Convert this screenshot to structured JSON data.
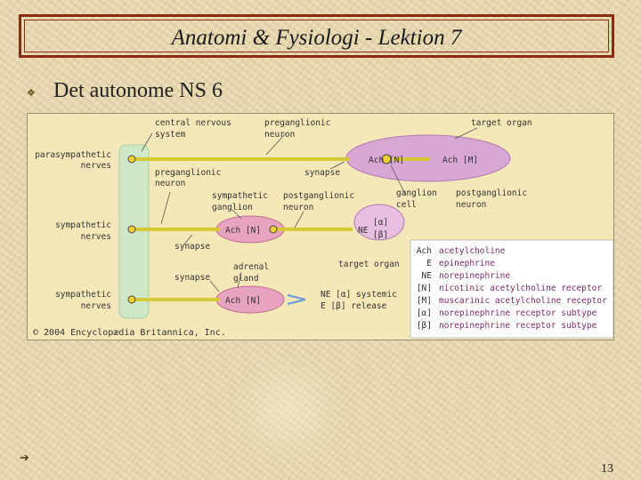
{
  "slide": {
    "title": "Anatomi & Fysiologi - Lektion 7",
    "bullet_text": "Det autonome NS 6",
    "page_number": "13"
  },
  "figure": {
    "labels": {
      "cns": [
        "central nervous",
        "system"
      ],
      "pre_neuron": [
        "preganglionic",
        "neuron"
      ],
      "target_organ_top": "target organ",
      "parasym": [
        "parasympathetic",
        "nerves"
      ],
      "pre_neuron_2": [
        "preganglionic",
        "neuron"
      ],
      "synapse_1": "synapse",
      "ach_n_1": "Ach [N]",
      "ach_m": "Ach [M]",
      "symp_ganglion": [
        "sympathetic",
        "ganglion"
      ],
      "post_neuron_1": [
        "postganglionic",
        "neuron"
      ],
      "ganglion_cell": [
        "ganglion",
        "cell"
      ],
      "post_neuron_2": [
        "postganglionic",
        "neuron"
      ],
      "sym_nerves_1": [
        "sympathetic",
        "nerves"
      ],
      "ach_n_2": "Ach [N]",
      "ne_1": "NE",
      "alpha_1": "[α]",
      "beta_1": "[β]",
      "synapse_2": "synapse",
      "target_organ_mid": "target organ",
      "adrenal": [
        "adrenal",
        "gland"
      ],
      "synapse_3": "synapse",
      "sym_nerves_2": [
        "sympathetic",
        "nerves"
      ],
      "ach_n_3": "Ach [N]",
      "release_1": "NE [α] systemic",
      "release_2": "E  [β] release",
      "copyright": "© 2004 Encyclopædia Britannica, Inc."
    },
    "legend": [
      {
        "abbr": "Ach",
        "desc": "acetylcholine"
      },
      {
        "abbr": "E",
        "desc": "epinephrine"
      },
      {
        "abbr": "NE",
        "desc": "norepinephrine"
      },
      {
        "abbr": "[N]",
        "desc": "nicotinic acetylcholine receptor"
      },
      {
        "abbr": "[M]",
        "desc": "muscarinic acetylcholine receptor"
      },
      {
        "abbr": "[α]",
        "desc": "norepinephrine receptor subtype"
      },
      {
        "abbr": "[β]",
        "desc": "norepinephrine receptor subtype"
      }
    ],
    "colors": {
      "panel": "#f4e8b8",
      "cns_column": "#cfe8c8",
      "organ": "#d9a7d6",
      "ganglion": "#e8a3c0",
      "axon": "#d6c936",
      "terminal": "#f0d030",
      "legend_bg": "#ffffff",
      "legend_text": "#7a2a6a"
    }
  },
  "icons": {
    "bullet": "diamond-bullet-icon",
    "nav": "arrow-right-icon"
  }
}
